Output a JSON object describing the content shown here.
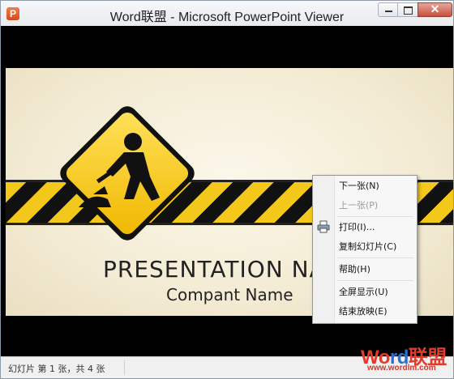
{
  "window": {
    "title": "Word联盟 - Microsoft PowerPoint Viewer",
    "app_icon_letter": "P",
    "close_label": "✕"
  },
  "slide": {
    "title": "PRESENTATION  NA",
    "subtitle": "Compant Name"
  },
  "context_menu": {
    "items": [
      {
        "label": "下一张(N)",
        "enabled": true
      },
      {
        "label": "上一张(P)",
        "enabled": false
      },
      {
        "label": "打印(I)...",
        "enabled": true,
        "icon": "printer-icon"
      },
      {
        "label": "复制幻灯片(C)",
        "enabled": true
      },
      {
        "label": "帮助(H)",
        "enabled": true
      },
      {
        "label": "全屏显示(U)",
        "enabled": true
      },
      {
        "label": "结束放映(E)",
        "enabled": true
      }
    ]
  },
  "status_bar": {
    "text": "幻灯片 第 1 张，共 4 张"
  },
  "watermark": {
    "part1": "Wo",
    "part2": "rd",
    "part3": "联盟",
    "url": "www.wordlm.com"
  },
  "colors": {
    "accent_yellow": "#f3c81a",
    "stripe_black": "#111111",
    "close_red": "#c7503e"
  }
}
